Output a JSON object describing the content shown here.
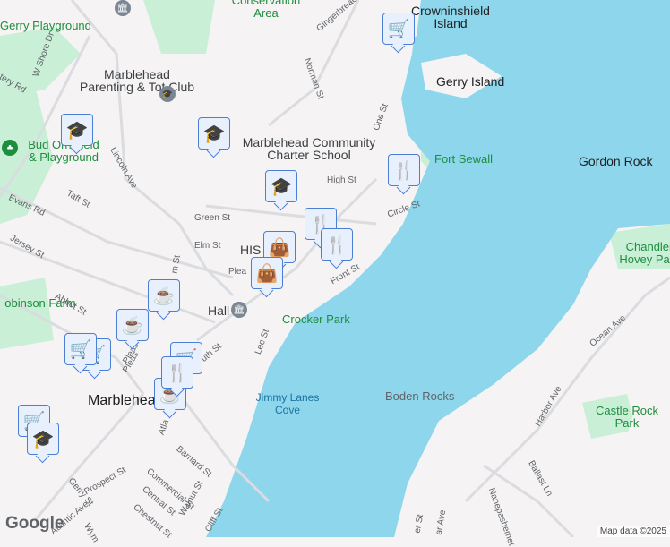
{
  "places": {
    "gerry_playground": "Gerry Playground",
    "conservation_area": "Conservation Area",
    "crowninshield_island": "Crowninshield Island",
    "gerry_island": "Gerry Island",
    "tot_club": "Marblehead Parenting & Tot Club",
    "charter_school": "Marblehead Community Charter School",
    "bud_orne": "Bud Ornefield & Playground",
    "fort_sewall": "Fort Sewall",
    "gordon_rock": "Gordon Rock",
    "chandler_hovey": "Chandler Hovey Park",
    "robinson_farm": "obinson Farm",
    "crocker_park": "Crocker Park",
    "boden_rocks": "Boden Rocks",
    "jimmy_lanes_cove": "Jimmy Lanes Cove",
    "castle_rock": "Castle Rock Park",
    "marblehead": "Marblehead",
    "historic": "HIS",
    "hall": "Hall"
  },
  "streets": [
    "W Shore Dr",
    "tery Rd",
    "Lincoln Ave",
    "Taft St",
    "Evans Rd",
    "Jersey St",
    "Green St",
    "Elm St",
    "Abbot St",
    "Gingerbread Hill",
    "Norman St",
    "One St",
    "High St",
    "Circle St",
    "Front St",
    "Lee St",
    "Pleas",
    "Prospect St",
    "Barnard St",
    "Commercial St",
    "Central St",
    "Chestnut St",
    "Walnut St",
    "Cliff St",
    "Gerry St",
    "Atlantic Ave",
    "Wym",
    "Harbor Ave",
    "Ocean Ave",
    "Ballast Ln",
    "Nanepashemet",
    "er St",
    "ar Ave",
    "Atla",
    "uth St",
    "m St",
    "Plea",
    "Pleas"
  ],
  "markers": [
    "grocery",
    "education",
    "education",
    "education",
    "restaurant",
    "restaurant",
    "shopping",
    "shopping",
    "coffee",
    "coffee",
    "coffee",
    "restaurant",
    "grocery",
    "grocery",
    "grocery",
    "education",
    "restaurant",
    "grocery"
  ],
  "footer": {
    "logo": "Google",
    "attribution": "Map data ©2025"
  },
  "colors": {
    "water": "#8dd6ec",
    "park": "#c9efd6",
    "land": "#f5f3f3",
    "marker": "#0b3d63"
  }
}
